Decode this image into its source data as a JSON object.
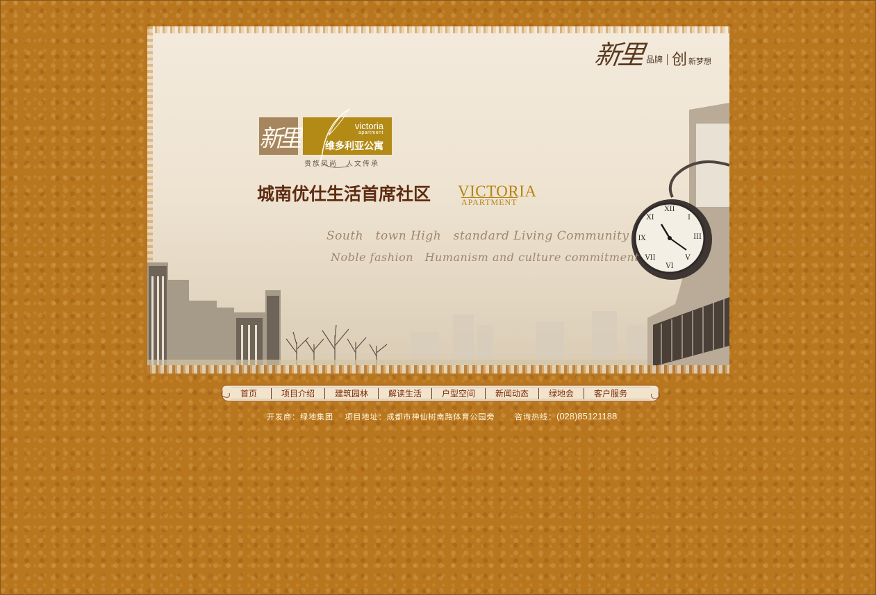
{
  "brand": {
    "mark": "新里",
    "pinpai": "品牌",
    "chuang": "创",
    "xinmengxiang": "新梦想"
  },
  "logo": {
    "xinli": "新里",
    "en": "victoria",
    "en_sub": "apartment",
    "cn": "维多利亚公寓",
    "tagline": "贵族风尚　人文传承"
  },
  "headline": "城南优仕生活首席社区",
  "victoria": {
    "big": "VICTORIA",
    "small": "APARTMENT"
  },
  "script_lines": [
    "South　town High　standard Living Community",
    "Noble fashion　Humanism and culture commitment"
  ],
  "nav": {
    "items": [
      "首页",
      "项目介绍",
      "建筑园林",
      "解读生活",
      "户型空间",
      "新闻动态",
      "绿地会",
      "客户服务"
    ]
  },
  "footer": {
    "developer": "开发商：绿地集团",
    "address": "项目地址：成都市神仙树南路体育公园旁",
    "hotline_label": "咨询热线：",
    "hotline": "(028)85121188"
  },
  "colors": {
    "page_bg": "#b8761f",
    "banner_bg": "#f3eadc",
    "headline": "#5e2c12",
    "gold": "#b38a16",
    "nav_text": "#7a2a0c"
  }
}
